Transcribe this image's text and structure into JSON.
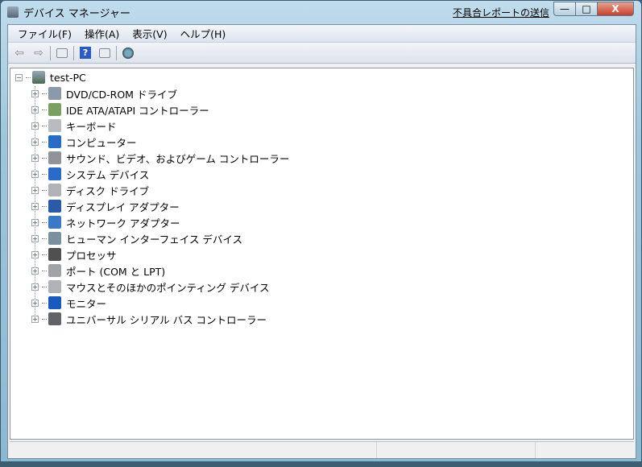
{
  "window": {
    "title": "デバイス マネージャー",
    "report_link": "不具合レポートの送信",
    "minimize": "—",
    "maximize": "□",
    "close": "X"
  },
  "menu": [
    "ファイル(F)",
    "操作(A)",
    "表示(V)",
    "ヘルプ(H)"
  ],
  "toolbar": {
    "back": "⇦",
    "forward": "⇨",
    "help": "?"
  },
  "tree": {
    "root": "test-PC",
    "items": [
      {
        "label": "DVD/CD-ROM ドライブ",
        "icon": "dvd-drive-icon",
        "color": "#8a9aa8"
      },
      {
        "label": "IDE ATA/ATAPI コントローラー",
        "icon": "ide-controller-icon",
        "color": "#7aa060"
      },
      {
        "label": "キーボード",
        "icon": "keyboard-icon",
        "color": "#b8bcc0"
      },
      {
        "label": "コンピューター",
        "icon": "computer-icon",
        "color": "#2a6ac8"
      },
      {
        "label": "サウンド、ビデオ、およびゲーム コントローラー",
        "icon": "speaker-icon",
        "color": "#909498"
      },
      {
        "label": "システム デバイス",
        "icon": "system-device-icon",
        "color": "#2a6ac8"
      },
      {
        "label": "ディスク ドライブ",
        "icon": "disk-drive-icon",
        "color": "#b0b4b8"
      },
      {
        "label": "ディスプレイ アダプター",
        "icon": "display-adapter-icon",
        "color": "#2a5aa8"
      },
      {
        "label": "ネットワーク アダプター",
        "icon": "network-adapter-icon",
        "color": "#3a78c8"
      },
      {
        "label": "ヒューマン インターフェイス デバイス",
        "icon": "hid-icon",
        "color": "#7890a0"
      },
      {
        "label": "プロセッサ",
        "icon": "processor-icon",
        "color": "#505050"
      },
      {
        "label": "ポート (COM と LPT)",
        "icon": "port-icon",
        "color": "#a0a4a8"
      },
      {
        "label": "マウスとそのほかのポインティング デバイス",
        "icon": "mouse-icon",
        "color": "#b0b4b8"
      },
      {
        "label": "モニター",
        "icon": "monitor-icon",
        "color": "#1a5ac0"
      },
      {
        "label": "ユニバーサル シリアル バス コントローラー",
        "icon": "usb-icon",
        "color": "#606468"
      }
    ]
  }
}
